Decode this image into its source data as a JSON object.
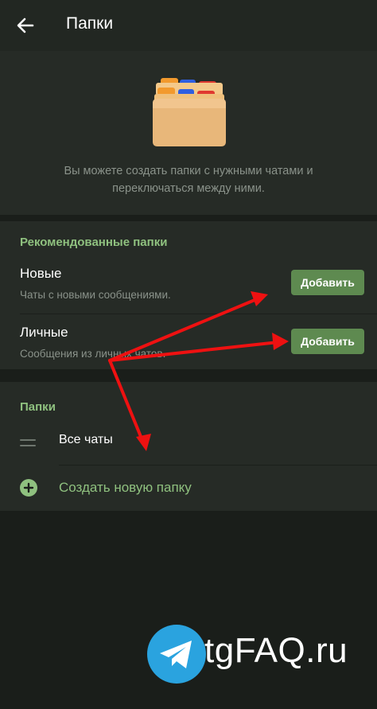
{
  "topbar": {
    "title": "Папки"
  },
  "hero": {
    "description": "Вы можете создать папки с нужными чатами и переключаться между ними."
  },
  "recommended": {
    "header": "Рекомендованные папки",
    "items": [
      {
        "title": "Новые",
        "subtitle": "Чаты с новыми сообщениями.",
        "button": "Добавить"
      },
      {
        "title": "Личные",
        "subtitle": "Сообщения из личных чатов.",
        "button": "Добавить"
      }
    ]
  },
  "folders": {
    "header": "Папки",
    "all_chats": "Все чаты",
    "create_label": "Создать новую папку"
  },
  "watermark": {
    "text": "tgFAQ.ru"
  },
  "colors": {
    "accent_green": "#8fc17f",
    "button_green": "#5e8a50",
    "annotation_red": "#ee1111",
    "telegram_blue": "#2aa3df"
  },
  "icons": [
    "back-arrow-icon",
    "folder-stack-icon",
    "drag-handle-icon",
    "plus-circle-icon",
    "telegram-logo-icon"
  ]
}
